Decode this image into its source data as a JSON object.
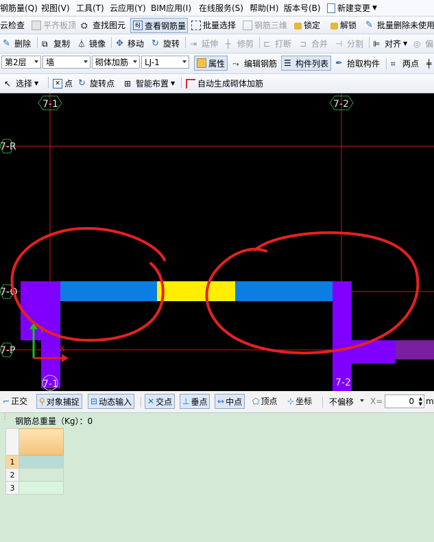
{
  "menubar": [
    "钢筋量(Q)",
    "视图(V)",
    "工具(T)",
    "云应用(Y)",
    "BIM应用(I)",
    "在线服务(S)",
    "帮助(H)",
    "版本号(B)",
    "新建变更"
  ],
  "toolbar1": {
    "cloud_check": "云检查",
    "flat_top": "平齐板顶",
    "find_elem": "查找图元",
    "view_rebar": "查看钢筋量",
    "batch_select": "批量选择",
    "rebar_3d": "钢筋三维",
    "lock": "锁定",
    "unlock": "解锁",
    "batch_delete": "批量删除未使用"
  },
  "toolbar2": {
    "delete": "删除",
    "copy": "复制",
    "mirror": "镜像",
    "move": "移动",
    "rotate": "旋转",
    "extend": "延伸",
    "trim": "修剪",
    "break": "打断",
    "merge": "合并",
    "split": "分割",
    "align": "对齐",
    "offset": "偏"
  },
  "toolbar3": {
    "floor": "第2层",
    "category": "墙",
    "subtype": "砌体加筋",
    "element": "LJ-1",
    "properties": "属性",
    "edit_rebar": "编辑钢筋",
    "component_list": "构件列表",
    "pick_component": "拾取构件",
    "two_points": "两点"
  },
  "toolbar4": {
    "select": "选择",
    "point": "点",
    "rotate_point": "旋转点",
    "smart_layout": "智能布置",
    "auto_generate": "自动生成砌体加筋"
  },
  "canvas": {
    "axis_labels": {
      "v1_top": "7-1",
      "v2_top": "7-2",
      "h_r": "7-R",
      "h_q": "7-Q",
      "h_p": "7-P",
      "v1_bottom": "7-1",
      "v2_bottom": "7-2"
    },
    "ucs_y": "Y",
    "ucs_x": "X"
  },
  "statusbar": {
    "ortho": "正交",
    "snap": "对象捕捉",
    "dynamic_input": "动态输入",
    "intersection": "交点",
    "perpendicular": "垂点",
    "midpoint": "中点",
    "vertex": "顶点",
    "coordinate": "坐标",
    "offset_mode": "不偏移",
    "x_label": "X=",
    "x_value": "0",
    "unit": "mm"
  },
  "panel": {
    "title": "钢筋总重量（Kg）：0",
    "rows": [
      "1",
      "2",
      "3"
    ]
  },
  "colors": {
    "wall_blue": "#0a7ee3",
    "rebar_yellow": "#ffee00",
    "column_purple": "#8000ff",
    "axis_red": "#ff2020",
    "annotation_red": "#e82020"
  }
}
